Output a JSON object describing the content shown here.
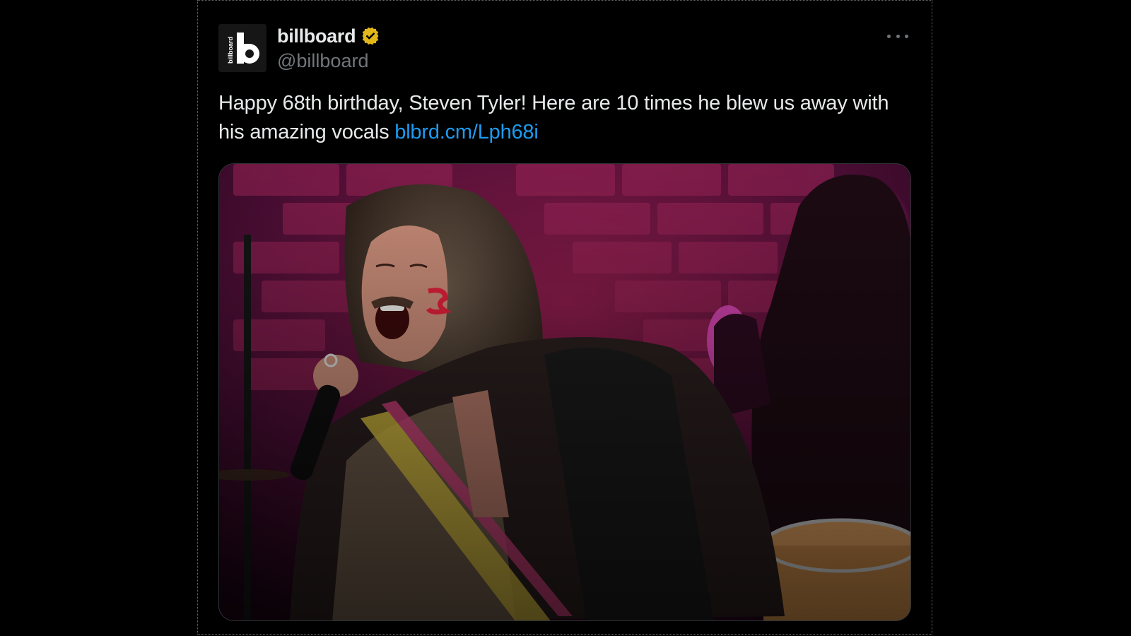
{
  "tweet": {
    "author": {
      "display_name": "billboard",
      "handle": "@billboard",
      "verified": true,
      "avatar_icon": "billboard-logo-icon",
      "avatar_wordmark": "billboard",
      "avatar_letter": "b"
    },
    "text": "Happy 68th birthday, Steven Tyler! Here are 10 times he blew us away with his amazing vocals ",
    "link_text": "blbrd.cm/Lph68i",
    "media": {
      "icon": "concert-photo-image"
    },
    "more_icon": "more-options-icon"
  },
  "colors": {
    "background": "#000000",
    "text_primary": "#e7e9ea",
    "text_secondary": "#71767b",
    "link": "#1d9bf0",
    "verified_badge": "#e2b719"
  }
}
